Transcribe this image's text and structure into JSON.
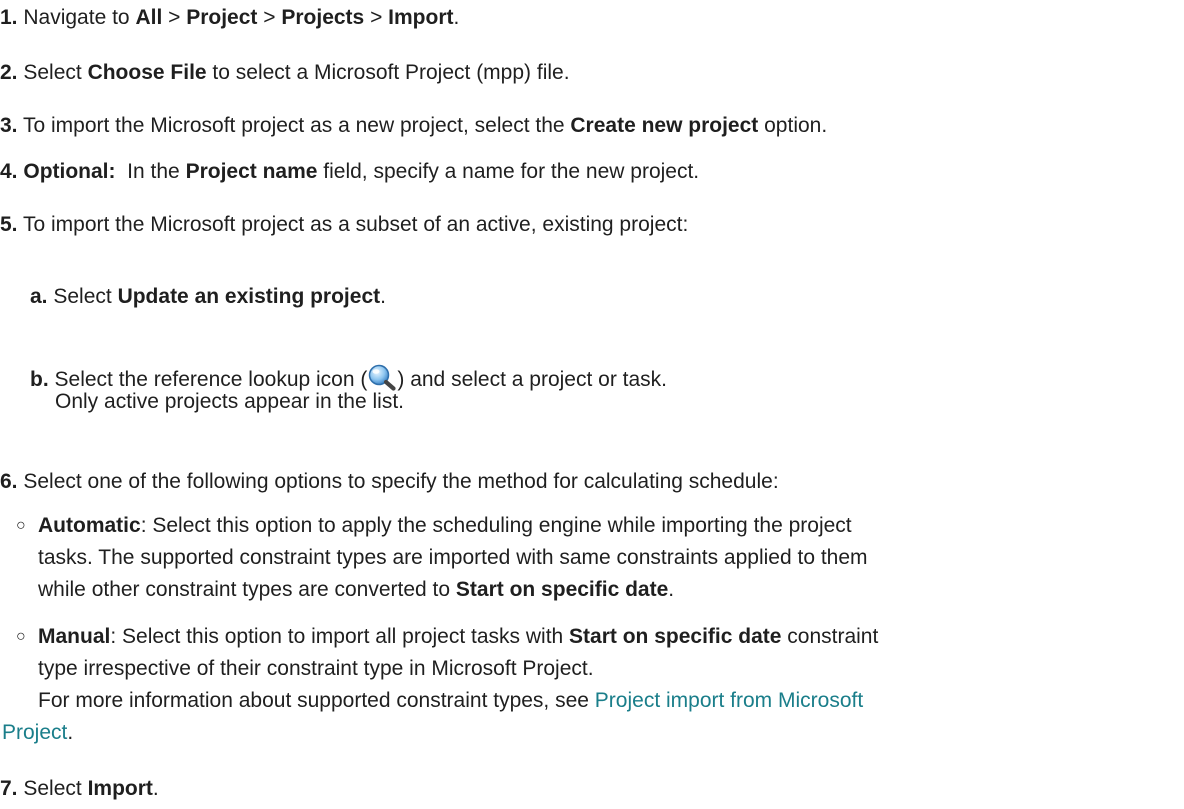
{
  "steps": {
    "s1": {
      "num": "1.",
      "text_a": "Navigate to ",
      "all": "All",
      "sep1": " > ",
      "project": "Project",
      "sep2": " > ",
      "projects": "Projects",
      "sep3": " > ",
      "import": "Import",
      "end": "."
    },
    "s2": {
      "num": "2.",
      "text_a": "Select ",
      "choose_file": "Choose File",
      "text_b": " to select a Microsoft Project (mpp) file."
    },
    "s3": {
      "num": "3.",
      "text_a": "To import the Microsoft project as a new project, select the ",
      "create_new": "Create new project",
      "text_b": " option."
    },
    "s4": {
      "num": "4.",
      "optional": "Optional:",
      "text_a": "  In the ",
      "project_name": "Project name",
      "text_b": " field, specify a name for the new project."
    },
    "s5": {
      "num": "5.",
      "text": "To import the Microsoft project as a subset of an active, existing project:"
    },
    "s5a": {
      "num": "a.",
      "text_a": "Select ",
      "update_existing": "Update an existing project",
      "end": "."
    },
    "s5b": {
      "num": "b.",
      "text_a": "Select the reference lookup icon (",
      "text_b": ") and select a project or task.",
      "line2": "Only active projects appear in the list."
    },
    "s6": {
      "num": "6.",
      "text": "Select one of the following options to specify the method for calculating schedule:"
    },
    "automatic": {
      "marker": "○",
      "label": "Automatic",
      "line1": ": Select this option to apply the scheduling engine while importing the project",
      "line2": "tasks. The supported constraint types are imported with same constraints applied to them",
      "line3_a": "while other constraint types are converted to ",
      "line3_bold": "Start on specific date",
      "line3_end": "."
    },
    "manual": {
      "marker": "○",
      "label": "Manual",
      "line1_a": ": Select this option to import all project tasks with ",
      "line1_bold": "Start on specific date",
      "line1_b": " constraint",
      "line2": "type irrespective of their constraint type in Microsoft Project."
    },
    "more_info": {
      "text_a": "For more information about supported constraint types, see ",
      "link_line1": "Project import from Microsoft",
      "link_line2": "Project",
      "end": "."
    },
    "s7": {
      "num": "7.",
      "text_a": "Select ",
      "import": "Import",
      "end": "."
    }
  },
  "icon": "magnifier-icon",
  "colors": {
    "link": "#1a7e8a",
    "text": "#1f1f1f"
  }
}
